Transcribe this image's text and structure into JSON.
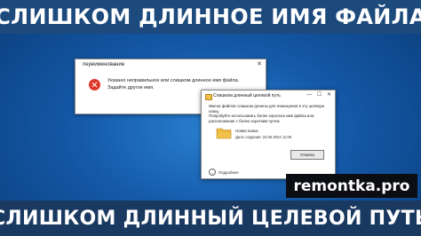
{
  "banner": {
    "top": "СЛИШКОМ ДЛИННОЕ ИМЯ ФАЙЛА",
    "bottom": "СЛИШКОМ ДЛИННЫЙ ЦЕЛЕВОЙ ПУТЬ"
  },
  "rename_dialog": {
    "title": "переименование",
    "close_glyph": "✕",
    "icon": "error-icon",
    "message_line1": "Указано неправильное или слишком длинное имя файла.",
    "message_line2": "Задайте другое имя."
  },
  "path_dialog": {
    "title": "Слишком длинный целевой путь",
    "minimize_glyph": "—",
    "maximize_glyph": "☐",
    "close_glyph": "✕",
    "message_line1": "Имена файлов слишком длинны для помещения в эту целевую папку.",
    "message_line2": "Попробуйте использовать более короткое имя файла или",
    "message_line3": "расположение с более коротким путем.",
    "folder_name": "Новая папка",
    "folder_date": "Дата создания: 23.05.2022 11:08",
    "cancel_label": "Отмена",
    "more_label": "Подробнее",
    "more_chevron": "⌄"
  },
  "watermark": "remontka.pro",
  "colors": {
    "banner": "#1d4a7c",
    "error_red": "#e0372c",
    "folder_yellow": "#f2c14b",
    "watermark_bg": "#0b0d12"
  }
}
